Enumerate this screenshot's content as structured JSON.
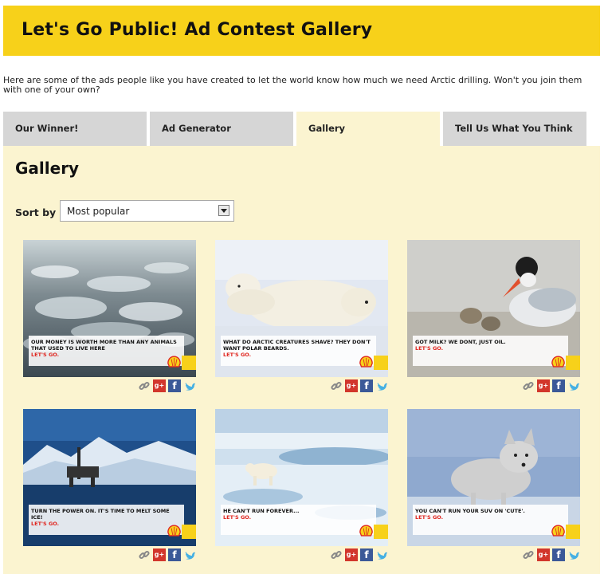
{
  "header": {
    "title": "Let's Go Public! Ad Contest Gallery"
  },
  "intro": "Here are some of the ads people like you have created to let the world know how much we need Arctic drilling. Won't you join them with one of your own?",
  "tabs": [
    {
      "label": "Our Winner!"
    },
    {
      "label": "Ad Generator"
    },
    {
      "label": "Gallery"
    },
    {
      "label": "Tell Us What You Think"
    }
  ],
  "gallery": {
    "heading": "Gallery",
    "sort_label": "Sort by",
    "sort_value": "Most popular"
  },
  "tagline": "LET'S GO.",
  "ads": [
    {
      "caption": "OUR MONEY IS WORTH MORE THAN ANY ANIMALS THAT USED TO LIVE HERE",
      "scene": "sea-ice"
    },
    {
      "caption": "WHAT DO ARCTIC CREATURES SHAVE? THEY DON'T WANT POLAR BEARDS.",
      "scene": "polar-bears"
    },
    {
      "caption": "GOT MILK? WE DONT, JUST OIL.",
      "scene": "tern"
    },
    {
      "caption": "TURN THE POWER ON. IT'S TIME TO MELT SOME ICE!",
      "scene": "oil-rig"
    },
    {
      "caption": "HE CAN'T RUN FOREVER...",
      "scene": "bear-on-ice"
    },
    {
      "caption": "YOU CAN'T RUN YOUR SUV ON 'CUTE'.",
      "scene": "arctic-fox"
    }
  ],
  "colors": {
    "header": "#f7d11a",
    "panel": "#fbf4d0",
    "tab": "#d6d6d6",
    "tagline": "#e0261f"
  }
}
